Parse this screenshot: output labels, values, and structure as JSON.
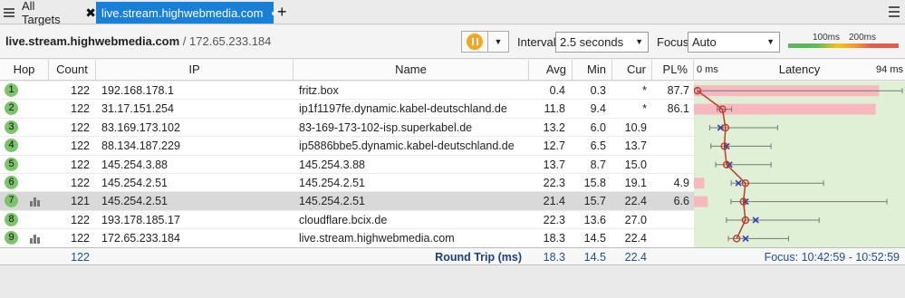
{
  "tabs": {
    "all_label": "All Targets",
    "active_label": "live.stream.highwebmedia.com"
  },
  "toolbar": {
    "host": "live.stream.highwebmedia.com",
    "separator_ip": " / 172.65.233.184",
    "interval_label": "Interval",
    "interval_value": "2.5 seconds",
    "focus_label": "Focus",
    "focus_value": "Auto",
    "scale_100": "100ms",
    "scale_200": "200ms"
  },
  "columns": {
    "hop": "Hop",
    "count": "Count",
    "ip": "IP",
    "name": "Name",
    "avg": "Avg",
    "min": "Min",
    "cur": "Cur",
    "pl": "PL%",
    "latency": "Latency",
    "lat_min": "0 ms",
    "lat_max": "94 ms"
  },
  "rows": [
    {
      "hop": "1",
      "count": "122",
      "ip": "192.168.178.1",
      "name": "fritz.box",
      "avg": "0.4",
      "min": "0.3",
      "cur": "*",
      "pl": "87.7",
      "graph": false
    },
    {
      "hop": "2",
      "count": "122",
      "ip": "31.17.151.254",
      "name": "ip1f1197fe.dynamic.kabel-deutschland.de",
      "avg": "11.8",
      "min": "9.4",
      "cur": "*",
      "pl": "86.1",
      "graph": false
    },
    {
      "hop": "3",
      "count": "122",
      "ip": "83.169.173.102",
      "name": "83-169-173-102-isp.superkabel.de",
      "avg": "13.2",
      "min": "6.0",
      "cur": "10.9",
      "pl": "",
      "graph": false
    },
    {
      "hop": "4",
      "count": "122",
      "ip": "88.134.187.229",
      "name": "ip5886bbe5.dynamic.kabel-deutschland.de",
      "avg": "12.7",
      "min": "6.5",
      "cur": "13.7",
      "pl": "",
      "graph": false
    },
    {
      "hop": "5",
      "count": "122",
      "ip": "145.254.3.88",
      "name": "145.254.3.88",
      "avg": "13.7",
      "min": "8.7",
      "cur": "15.0",
      "pl": "",
      "graph": false
    },
    {
      "hop": "6",
      "count": "122",
      "ip": "145.254.2.51",
      "name": "145.254.2.51",
      "avg": "22.3",
      "min": "15.8",
      "cur": "19.1",
      "pl": "4.9",
      "graph": false
    },
    {
      "hop": "7",
      "count": "121",
      "ip": "145.254.2.51",
      "name": "145.254.2.51",
      "avg": "21.4",
      "min": "15.7",
      "cur": "22.4",
      "pl": "6.6",
      "graph": true
    },
    {
      "hop": "8",
      "count": "122",
      "ip": "193.178.185.17",
      "name": "cloudflare.bcix.de",
      "avg": "22.3",
      "min": "13.6",
      "cur": "27.0",
      "pl": "",
      "graph": false
    },
    {
      "hop": "9",
      "count": "122",
      "ip": "172.65.233.184",
      "name": "live.stream.highwebmedia.com",
      "avg": "18.3",
      "min": "14.5",
      "cur": "22.4",
      "pl": "",
      "graph": true
    }
  ],
  "latency_max_ms": 94,
  "latency_bars": [
    {
      "avg": 0.4,
      "min": 0.3,
      "max": 94,
      "cur": null,
      "loss": 87.7
    },
    {
      "avg": 11.8,
      "min": 9.4,
      "max": 16,
      "cur": null,
      "loss": 86.1
    },
    {
      "avg": 13.2,
      "min": 6.0,
      "max": 37,
      "cur": 10.9,
      "loss": 0
    },
    {
      "avg": 12.7,
      "min": 6.5,
      "max": 34,
      "cur": 13.7,
      "loss": 0
    },
    {
      "avg": 13.7,
      "min": 8.7,
      "max": 34,
      "cur": 15.0,
      "loss": 0
    },
    {
      "avg": 22.3,
      "min": 15.8,
      "max": 58,
      "cur": 19.1,
      "loss": 4.9
    },
    {
      "avg": 21.4,
      "min": 15.7,
      "max": 87,
      "cur": 22.4,
      "loss": 6.6
    },
    {
      "avg": 22.3,
      "min": 13.6,
      "max": 56,
      "cur": 27.0,
      "loss": 0
    },
    {
      "avg": 18.3,
      "min": 14.5,
      "max": 42,
      "cur": 22.4,
      "loss": 0
    }
  ],
  "footer": {
    "count": "122",
    "label": "Round Trip (ms)",
    "avg": "18.3",
    "min": "14.5",
    "cur": "22.4",
    "focus": "Focus: 10:42:59 - 10:52:59"
  },
  "colors": {
    "accent": "#1a7fd6",
    "hop_green": "#7cc46b",
    "loss_pink": "#f7b8c0",
    "graph_bg": "#dff0d6",
    "avg_line": "#c0392b",
    "cur_mark": "#2c3fb8"
  }
}
